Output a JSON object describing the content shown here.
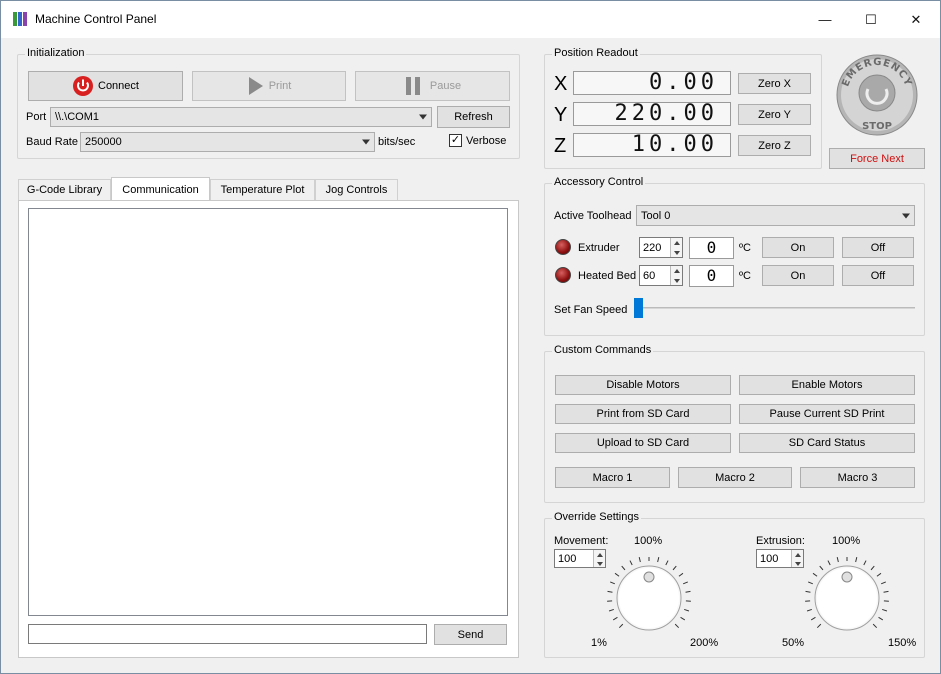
{
  "window": {
    "title": "Machine Control Panel",
    "minimize": "—",
    "maximize": "☐",
    "close": "✕"
  },
  "init": {
    "title": "Initialization",
    "connect": "Connect",
    "print": "Print",
    "pause": "Pause",
    "port_label": "Port",
    "port_value": "\\\\.\\COM1",
    "refresh": "Refresh",
    "baud_label": "Baud Rate",
    "baud_value": "250000",
    "baud_unit": "bits/sec",
    "verbose": "Verbose",
    "verbose_check": "✓"
  },
  "tabs": [
    "G-Code Library",
    "Communication",
    "Temperature Plot",
    "Jog Controls"
  ],
  "comm": {
    "send": "Send"
  },
  "position": {
    "title": "Position Readout",
    "x_label": "X",
    "x_value": "0.00",
    "zero_x": "Zero X",
    "y_label": "Y",
    "y_value": "220.00",
    "zero_y": "Zero Y",
    "z_label": "Z",
    "z_value": "10.00",
    "zero_z": "Zero Z"
  },
  "estop": {
    "line1": "EMERGENCY",
    "line2": "STOP",
    "force_next": "Force Next"
  },
  "accessory": {
    "title": "Accessory Control",
    "toolhead_label": "Active Toolhead",
    "toolhead_value": "Tool 0",
    "extruder_label": "Extruder",
    "extruder_set": "220",
    "extruder_reading": "0",
    "bed_label": "Heated Bed",
    "bed_set": "60",
    "bed_reading": "0",
    "unit": "ºC",
    "on": "On",
    "off": "Off",
    "fan_label": "Set Fan Speed",
    "fan_speed": 0
  },
  "custom": {
    "title": "Custom Commands",
    "disable_motors": "Disable Motors",
    "enable_motors": "Enable Motors",
    "print_sd": "Print from SD Card",
    "pause_sd": "Pause Current SD Print",
    "upload_sd": "Upload to SD Card",
    "sd_status": "SD Card Status",
    "macro1": "Macro 1",
    "macro2": "Macro 2",
    "macro3": "Macro 3"
  },
  "override": {
    "title": "Override Settings",
    "movement_label": "Movement:",
    "movement_value": "100",
    "movement_top": "100%",
    "movement_min": "1%",
    "movement_max": "200%",
    "extrusion_label": "Extrusion:",
    "extrusion_value": "100",
    "extrusion_top": "100%",
    "extrusion_min": "50%",
    "extrusion_max": "150%"
  },
  "colors": {
    "accent": "#0078d7",
    "danger": "#d01010",
    "connect_icon": "#d82020"
  }
}
